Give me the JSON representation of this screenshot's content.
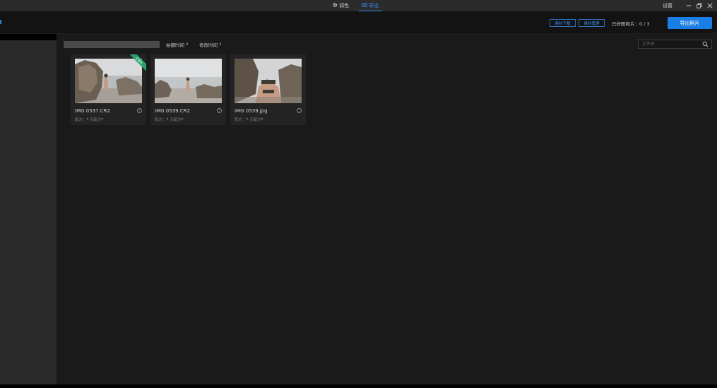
{
  "titlebar": {
    "tabs": [
      {
        "label": "调色",
        "icon": "gear-icon",
        "active": false
      },
      {
        "label": "导出",
        "icon": "export-icon",
        "active": true
      }
    ],
    "settings_label": "设置"
  },
  "toolbar": {
    "material_download": "素材下载",
    "material_manage": "素材管理",
    "exported_count": "已修图照片：0 / 3",
    "export_button": "导出照片"
  },
  "filter": {
    "sort_shoot_time": "拍摄时间",
    "sort_modify_time": "修改时间",
    "search_placeholder": "文件名"
  },
  "photos": [
    {
      "filename": "IMG 0537.CR2",
      "preset_label": "配方：",
      "preset_value": "无配方",
      "badge": "已调色"
    },
    {
      "filename": "IMG 0539.CR2",
      "preset_label": "配方：",
      "preset_value": "无配方",
      "badge": ""
    },
    {
      "filename": "IMG 0539.jpg",
      "preset_label": "配方：",
      "preset_value": "无配方",
      "badge": ""
    }
  ],
  "colors": {
    "accent": "#1a7ee6",
    "badge": "#2aa36b",
    "background": "#1a1a1a",
    "sidebar": "#2a2a2a"
  }
}
